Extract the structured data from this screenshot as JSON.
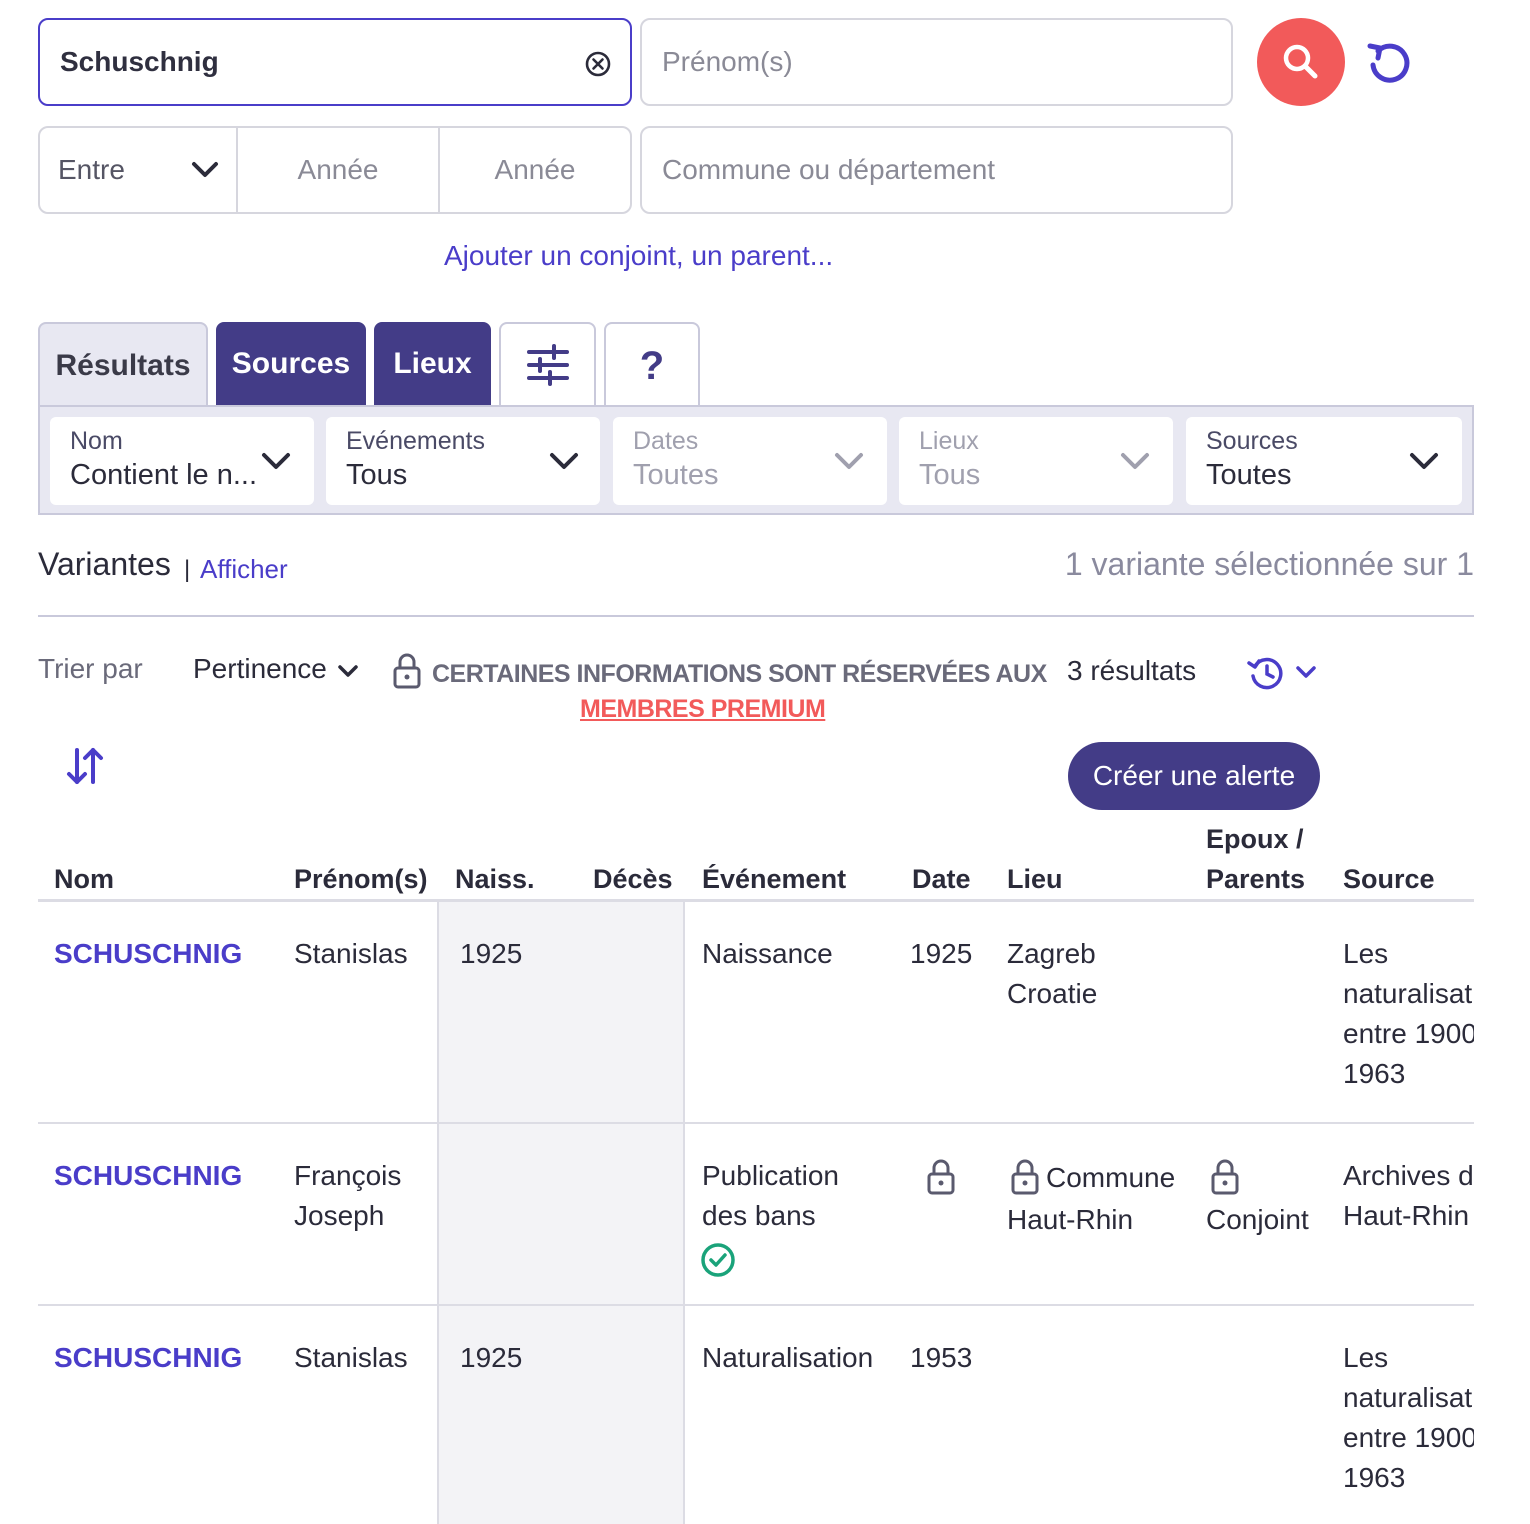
{
  "search": {
    "surname_value": "Schuschnig",
    "firstname_placeholder": "Prénom(s)",
    "date_mode": "Entre",
    "year_from_placeholder": "Année",
    "year_to_placeholder": "Année",
    "place_placeholder": "Commune ou département",
    "add_relative_link": "Ajouter un conjoint, un parent..."
  },
  "tabs": [
    {
      "label": "Résultats"
    },
    {
      "label": "Sources"
    },
    {
      "label": "Lieux"
    },
    {
      "label": ""
    },
    {
      "label": "?"
    }
  ],
  "filters": [
    {
      "title": "Nom",
      "value": "Contient le n..."
    },
    {
      "title": "Evénements",
      "value": "Tous"
    },
    {
      "title": "Dates",
      "value": "Toutes"
    },
    {
      "title": "Lieux",
      "value": "Tous"
    },
    {
      "title": "Sources",
      "value": "Toutes"
    }
  ],
  "variants": {
    "label": "Variantes",
    "separator": "|",
    "link": "Afficher",
    "summary": "1 variante sélectionnée sur 1"
  },
  "sort": {
    "label": "Trier par",
    "value": "Pertinence"
  },
  "premium": {
    "notice": "CERTAINES INFORMATIONS SONT RÉSERVÉES AUX",
    "link": "MEMBRES PREMIUM"
  },
  "results_count": "3 résultats",
  "alert_button": "Créer une alerte",
  "table": {
    "headers": {
      "nom": "Nom",
      "prenoms": "Prénom(s)",
      "naiss": "Naiss.",
      "deces": "Décès",
      "evenement": "Événement",
      "date": "Date",
      "lieu": "Lieu",
      "epoux_line1": "Epoux /",
      "epoux_line2": "Parents",
      "source": "Source"
    },
    "rows": [
      {
        "nom": "SCHUSCHNIG",
        "prenom_line1": "Stanislas",
        "prenom_line2": "",
        "naiss": "1925",
        "event_line1": "Naissance",
        "event_line2": "",
        "date": "1925",
        "lieu_line1": "Zagreb",
        "lieu_line2": "Croatie",
        "epoux": "",
        "source_lines": [
          "Les",
          "naturalisat",
          "entre 1900",
          "1963"
        ]
      },
      {
        "nom": "SCHUSCHNIG",
        "prenom_line1": "François",
        "prenom_line2": "Joseph",
        "naiss": "",
        "event_line1": "Publication",
        "event_line2": "des bans",
        "date": "",
        "lieu_line1": "Commune",
        "lieu_line2": "Haut-Rhin",
        "epoux": "Conjoint",
        "source_lines": [
          "Archives du",
          "Haut-Rhin"
        ]
      },
      {
        "nom": "SCHUSCHNIG",
        "prenom_line1": "Stanislas",
        "prenom_line2": "",
        "naiss": "1925",
        "event_line1": "Naturalisation",
        "event_line2": "",
        "date": "1953",
        "lieu_line1": "",
        "lieu_line2": "",
        "epoux": "",
        "source_lines": [
          "Les",
          "naturalisat",
          "entre 1900",
          "1963"
        ]
      }
    ]
  },
  "colors": {
    "accent": "#4a3dc9",
    "dark_tab": "#433c87",
    "search_button": "#f25a5a",
    "premium_link": "#f25a5a",
    "verified": "#1aa37a"
  }
}
